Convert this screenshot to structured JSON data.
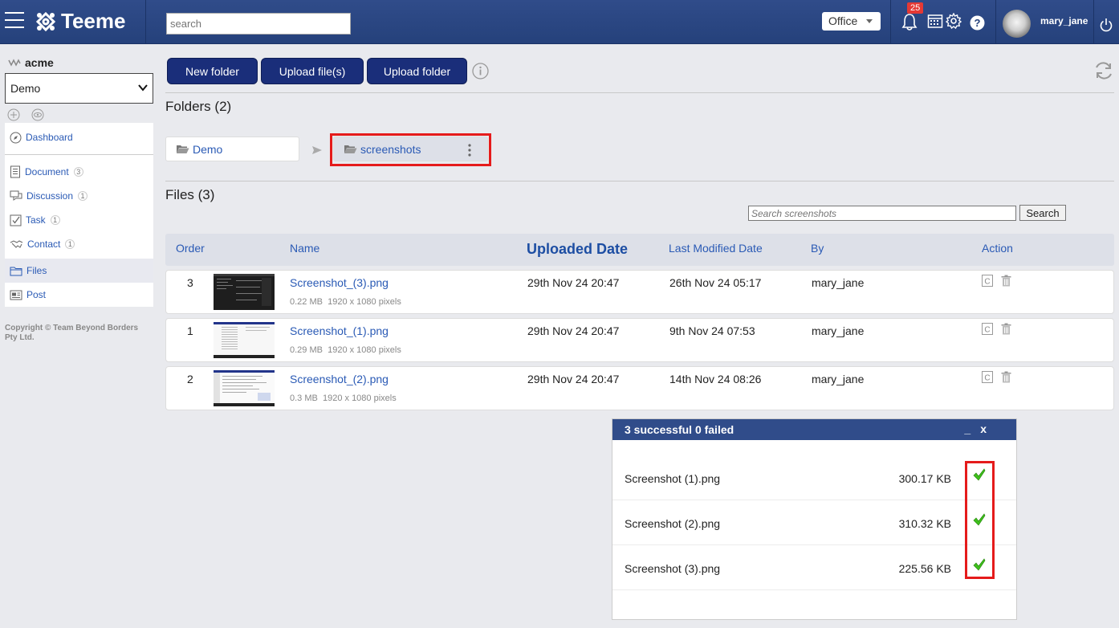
{
  "app": {
    "name": "Teeme"
  },
  "topbar": {
    "search_placeholder": "search",
    "office_label": "Office",
    "notifications_count": "25",
    "username": "mary_jane"
  },
  "sidebar": {
    "org_name": "acme",
    "workspace_selected": "Demo",
    "items": [
      {
        "label": "Dashboard",
        "icon": "compass-icon"
      },
      {
        "label": "Document",
        "icon": "document-icon",
        "count": "3"
      },
      {
        "label": "Discussion",
        "icon": "chat-icon",
        "count": "1"
      },
      {
        "label": "Task",
        "icon": "checkbox-icon",
        "count": "1"
      },
      {
        "label": "Contact",
        "icon": "handshake-icon",
        "count": "1"
      },
      {
        "label": "Files",
        "icon": "folder-icon"
      },
      {
        "label": "Post",
        "icon": "post-icon"
      }
    ],
    "copyright": "Copyright © Team Beyond Borders Pty Ltd."
  },
  "toolbar": {
    "new_folder": "New folder",
    "upload_files": "Upload file(s)",
    "upload_folder": "Upload folder"
  },
  "folders": {
    "heading": "Folders (2)",
    "items": [
      {
        "name": "Demo"
      },
      {
        "name": "screenshots"
      }
    ]
  },
  "files": {
    "heading": "Files (3)",
    "search_placeholder": "Search screenshots",
    "search_button": "Search",
    "columns": {
      "order": "Order",
      "name": "Name",
      "uploaded": "Uploaded Date",
      "modified": "Last Modified Date",
      "by": "By",
      "action": "Action"
    },
    "rows": [
      {
        "order": "3",
        "name": "Screenshot_(3).png",
        "size": "0.22 MB",
        "dims": "1920 x 1080 pixels",
        "uploaded": "29th Nov 24 20:47",
        "modified": "26th Nov 24 05:17",
        "by": "mary_jane"
      },
      {
        "order": "1",
        "name": "Screenshot_(1).png",
        "size": "0.29 MB",
        "dims": "1920 x 1080 pixels",
        "uploaded": "29th Nov 24 20:47",
        "modified": "9th Nov 24 07:53",
        "by": "mary_jane"
      },
      {
        "order": "2",
        "name": "Screenshot_(2).png",
        "size": "0.3 MB",
        "dims": "1920 x 1080 pixels",
        "uploaded": "29th Nov 24 20:47",
        "modified": "14th Nov 24 08:26",
        "by": "mary_jane"
      }
    ]
  },
  "upload_panel": {
    "title": "3 successful 0 failed",
    "minimize": "_",
    "close": "x",
    "items": [
      {
        "name": "Screenshot (1).png",
        "size": "300.17 KB"
      },
      {
        "name": "Screenshot (2).png",
        "size": "310.32 KB"
      },
      {
        "name": "Screenshot (3).png",
        "size": "225.56 KB"
      }
    ]
  },
  "colors": {
    "header": "#304c8a",
    "button": "#1a2e7a",
    "link": "#2a5ab5",
    "highlight": "#e51b1b",
    "check": "#3ec01c"
  }
}
